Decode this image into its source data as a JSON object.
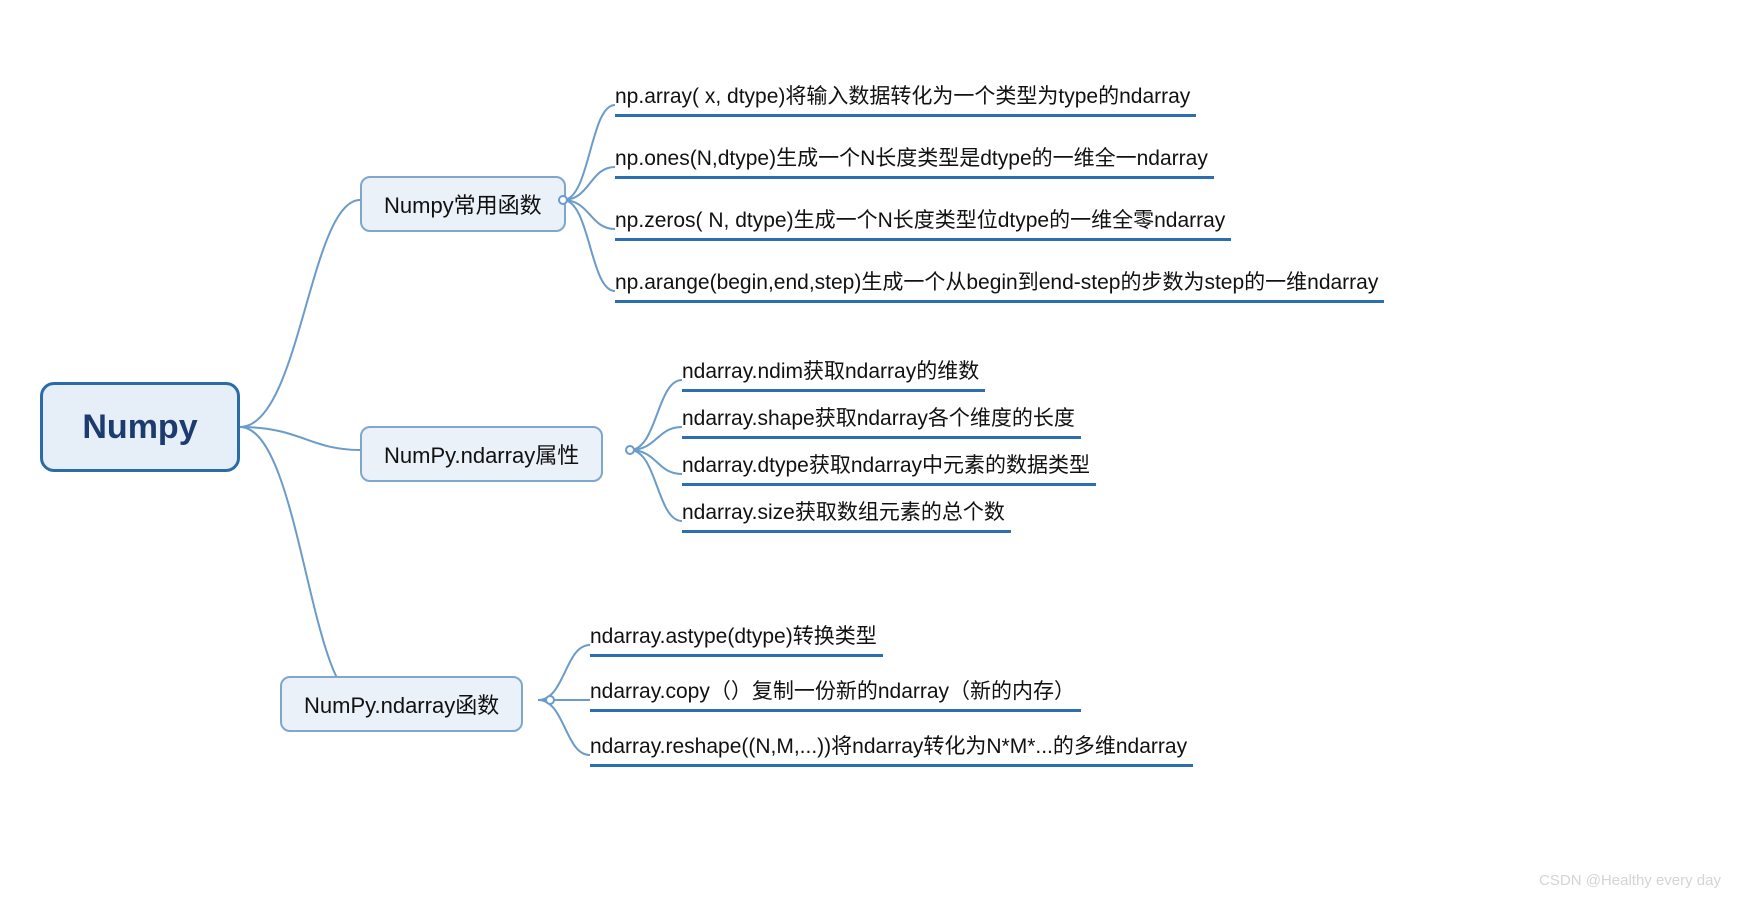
{
  "root": {
    "label": "Numpy"
  },
  "branches": [
    {
      "label": "Numpy常用函数",
      "leaves": [
        "np.array( x, dtype)将输入数据转化为一个类型为type的ndarray",
        "np.ones(N,dtype)生成一个N长度类型是dtype的一维全一ndarray",
        "np.zeros( N, dtype)生成一个N长度类型位dtype的一维全零ndarray",
        "np.arange(begin,end,step)生成一个从begin到end-step的步数为step的一维ndarray"
      ]
    },
    {
      "label": "NumPy.ndarray属性",
      "leaves": [
        "ndarray.ndim获取ndarray的维数",
        "ndarray.shape获取ndarray各个维度的长度",
        "ndarray.dtype获取ndarray中元素的数据类型",
        "ndarray.size获取数组元素的总个数"
      ]
    },
    {
      "label": "NumPy.ndarray函数",
      "leaves": [
        "ndarray.astype(dtype)转换类型",
        "ndarray.copy（）复制一份新的ndarray（新的内存）",
        "ndarray.reshape((N,M,...))将ndarray转化为N*M*...的多维ndarray"
      ]
    }
  ],
  "watermark": "CSDN @Healthy every day",
  "colors": {
    "stroke": "#6a9bc9",
    "underline": "#2d6eb3",
    "rootBorder": "#2b6ca8",
    "rootBg": "#e6eef7",
    "branchBg": "#eaf1f9"
  }
}
